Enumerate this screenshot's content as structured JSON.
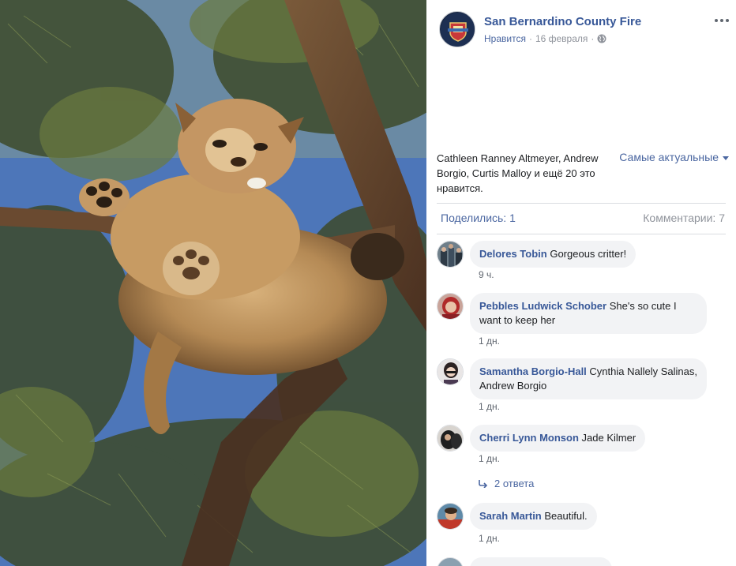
{
  "post": {
    "page_name": "San Bernardino County Fire",
    "like_link": "Нравится",
    "separator": "·",
    "date": "16 февраля",
    "likes_summary": "Cathleen Ranney Altmeyer, Andrew Borgio, Curtis Malloy и ещё 20 это нравится.",
    "sort_label": "Самые актуальные",
    "shares": "Поделились: 1",
    "comments_count": "Комментарии: 7"
  },
  "colors": {
    "link": "#385898",
    "secondary": "#90949c",
    "bubble": "#f2f3f5"
  },
  "icons": [
    "more-icon",
    "globe-icon",
    "caret-down-icon",
    "reply-arrow-icon"
  ],
  "comments": [
    {
      "author": "Delores Tobin",
      "text": "Gorgeous critter!",
      "time": "9 ч."
    },
    {
      "author": "Pebbles Ludwick Schober",
      "text": "She's so cute I want to keep her",
      "time": "1 дн."
    },
    {
      "author": "Samantha Borgio-Hall",
      "text": "Cynthia Nallely Salinas, Andrew Borgio",
      "time": "1 дн."
    },
    {
      "author": "Cherri Lynn Monson",
      "text": "Jade Kilmer",
      "time": "1 дн."
    },
    {
      "author": "Sarah Martin",
      "text": "Beautiful.",
      "time": "1 дн."
    }
  ],
  "replies_label": "2 ответа"
}
